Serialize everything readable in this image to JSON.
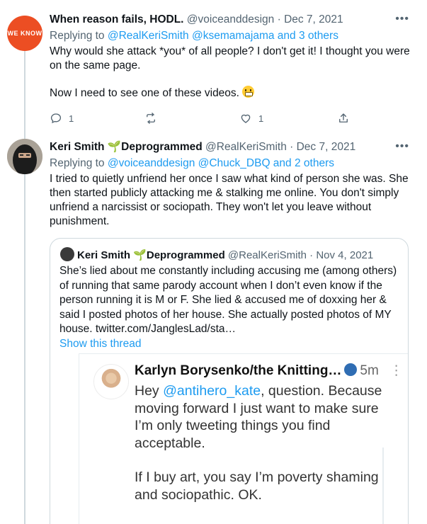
{
  "tweet1": {
    "avatar_text": "WE KNOW",
    "name": "When reason fails, HODL.",
    "handle": "@voiceanddesign",
    "date": "Dec 7, 2021",
    "replying_prefix": "Replying to ",
    "replying_mentions": "@RealKeriSmith @ksemamajama and 3 others",
    "body_line1": "Why would she attack *you* of all people? I don't get it! I thought you were on the same page.",
    "body_line2": "Now I need to see one of these videos.",
    "emoji": "grimacing-face",
    "reply_count": "1",
    "retweet_count": "",
    "like_count": "1"
  },
  "tweet2": {
    "name": "Keri Smith",
    "name_badge": "Deprogrammed",
    "handle": "@RealKeriSmith",
    "date": "Dec 7, 2021",
    "replying_prefix": "Replying to ",
    "replying_mentions": "@voiceanddesign @Chuck_DBQ and 2 others",
    "body": "I tried to quietly unfriend her once I saw what kind of person she was. She then started publicly attacking me & stalking me online. You don't simply unfriend a narcissist or sociopath. They won't let you leave without punishment."
  },
  "quote": {
    "name": "Keri Smith",
    "name_badge": "Deprogrammed",
    "handle": "@RealKeriSmith",
    "date": "Nov 4, 2021",
    "body": "She’s lied about me constantly including accusing me (among others) of running that same parody account when I don’t even know if the person running it is M or F. She lied & accused me of doxxing her & said I posted photos of her house. She actually posted photos of MY house. twitter.com/JanglesLad/sta…",
    "show_thread": "Show this thread"
  },
  "screenshot": {
    "name": "Karlyn Borysenko/the Knitting…",
    "time": "5m",
    "body_prefix": "Hey ",
    "mention": "@antihero_kate",
    "body_after_mention": ", question. Because moving forward I just want to make sure I’m only tweeting things you find acceptable.",
    "body_line2": "If I buy art, you say I’m poverty shaming and sociopathic. OK."
  },
  "colors": {
    "link": "#1d9bf0",
    "secondary_text": "#536471",
    "border": "#cfd9de",
    "avatar_brand": "#ec4e23"
  }
}
